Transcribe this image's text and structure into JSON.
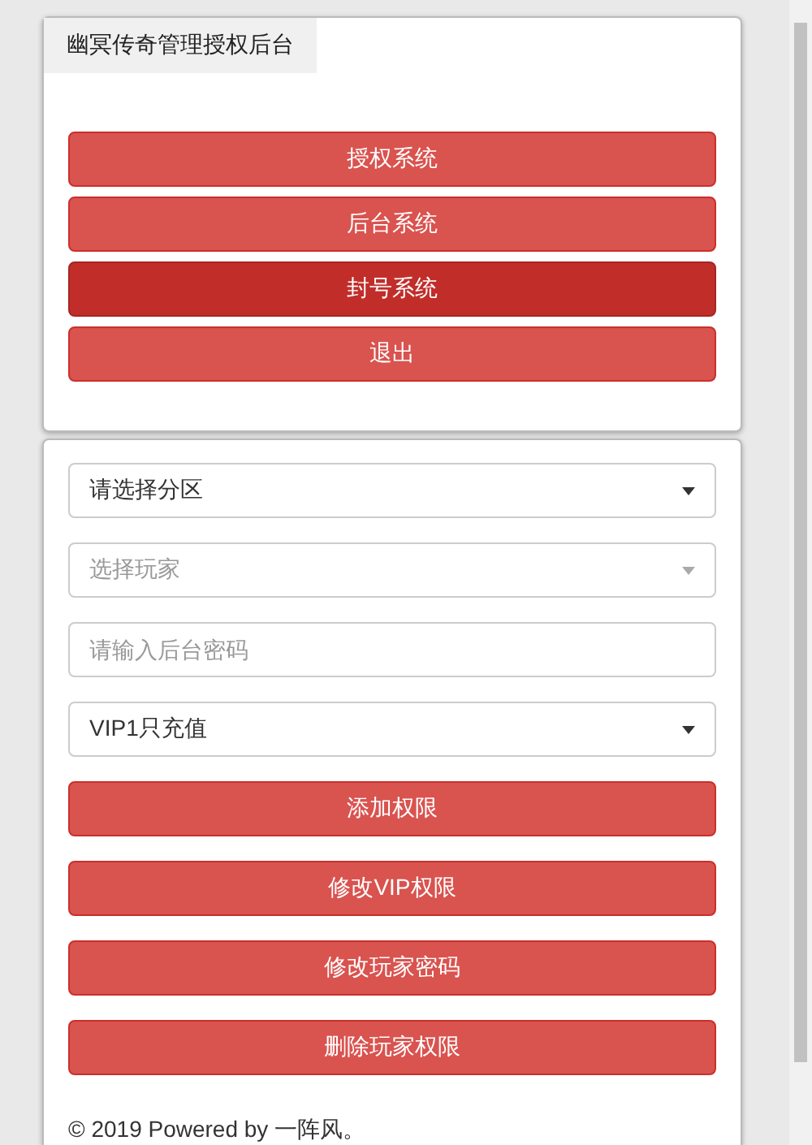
{
  "header": {
    "title": "幽冥传奇管理授权后台"
  },
  "nav_buttons": [
    {
      "label": "授权系统",
      "selected": false
    },
    {
      "label": "后台系统",
      "selected": false
    },
    {
      "label": "封号系统",
      "selected": true
    },
    {
      "label": "退出",
      "selected": false
    }
  ],
  "form": {
    "fields": [
      {
        "kind": "select",
        "value": "请选择分区",
        "disabled": false
      },
      {
        "kind": "select",
        "value": "选择玩家",
        "disabled": true
      },
      {
        "kind": "input",
        "placeholder": "请输入后台密码"
      },
      {
        "kind": "select",
        "value": "VIP1只充值",
        "disabled": false
      }
    ],
    "buttons": [
      "添加权限",
      "修改VIP权限",
      "修改玩家密码",
      "删除玩家权限"
    ]
  },
  "footer": "© 2019 Powered by 一阵风。"
}
